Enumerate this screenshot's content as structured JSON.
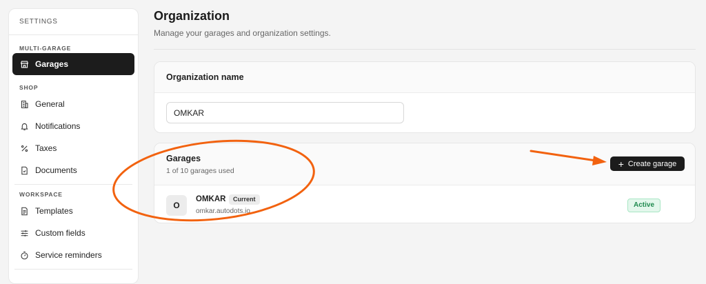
{
  "sidebar": {
    "header": "SETTINGS",
    "sections": [
      {
        "label": "MULTI-GARAGE",
        "items": [
          {
            "label": "Garages",
            "icon": "store-icon",
            "active": true
          }
        ]
      },
      {
        "label": "SHOP",
        "items": [
          {
            "label": "General",
            "icon": "building-icon"
          },
          {
            "label": "Notifications",
            "icon": "bell-icon"
          },
          {
            "label": "Taxes",
            "icon": "percent-icon"
          },
          {
            "label": "Documents",
            "icon": "document-check-icon"
          }
        ]
      },
      {
        "label": "WORKSPACE",
        "items": [
          {
            "label": "Templates",
            "icon": "file-text-icon"
          },
          {
            "label": "Custom fields",
            "icon": "sliders-icon"
          },
          {
            "label": "Service reminders",
            "icon": "timer-icon"
          }
        ]
      }
    ]
  },
  "page": {
    "title": "Organization",
    "subtitle": "Manage your garages and organization settings."
  },
  "org_card": {
    "title": "Organization name",
    "input_value": "OMKAR"
  },
  "garages_card": {
    "title": "Garages",
    "usage": "1 of 10 garages used",
    "create_button": "Create garage",
    "rows": [
      {
        "initial": "O",
        "name": "OMKAR",
        "badge": "Current",
        "url": "omkar.autodots.io",
        "status": "Active"
      }
    ]
  },
  "colors": {
    "annotation": "#f2620f",
    "active_nav": "#1c1c1c",
    "status_green": "#1f8a4f"
  }
}
